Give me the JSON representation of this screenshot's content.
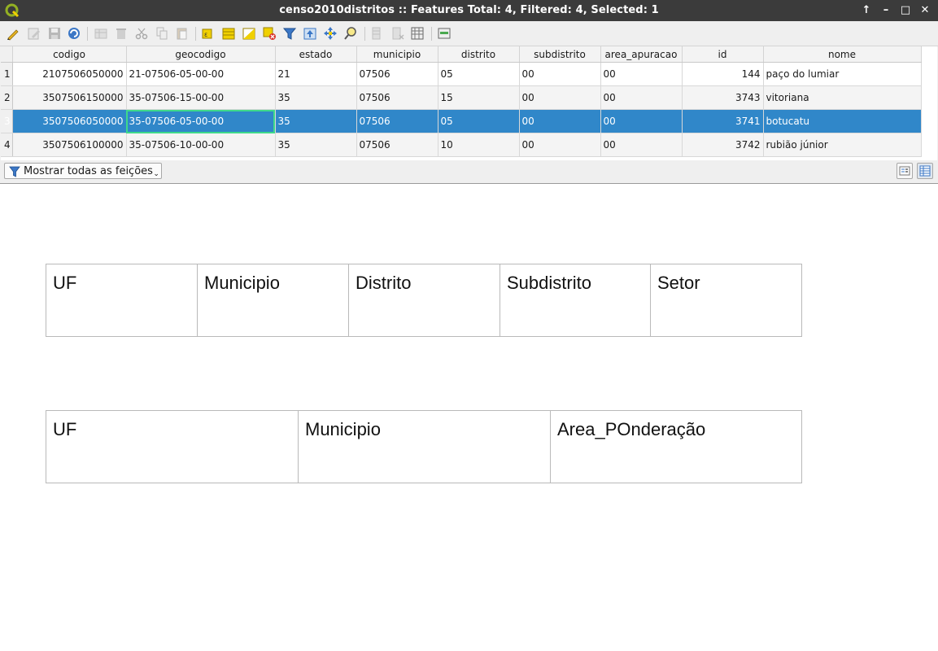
{
  "window": {
    "title": "censo2010distritos :: Features Total: 4, Filtered: 4, Selected: 1",
    "controls": [
      "↑",
      "–",
      "□",
      "✕"
    ]
  },
  "toolbar": {
    "icons": [
      "toggle-editing-icon",
      "multi-edit-icon",
      "save-edits-icon",
      "reload-icon",
      "add-feature-icon",
      "delete-feature-icon",
      "cut-icon",
      "copy-icon",
      "paste-icon",
      "select-by-expression-icon",
      "select-all-icon",
      "invert-selection-icon",
      "deselect-all-icon",
      "filter-select-icon",
      "move-selection-top-icon",
      "pan-to-selection-icon",
      "zoom-to-selection-icon",
      "new-field-icon",
      "delete-field-icon",
      "field-calculator-icon",
      "conditional-formatting-icon"
    ]
  },
  "table": {
    "columns": [
      "codigo",
      "geocodigo",
      "estado",
      "municipio",
      "distrito",
      "subdistrito",
      "area_apuracao",
      "id",
      "nome"
    ],
    "rows": [
      {
        "num": "1",
        "cells": [
          "2107506050000",
          "21-07506-05-00-00",
          "21",
          "07506",
          "05",
          "00",
          "00",
          "144",
          "paço do lumiar"
        ]
      },
      {
        "num": "2",
        "cells": [
          "3507506150000",
          "35-07506-15-00-00",
          "35",
          "07506",
          "15",
          "00",
          "00",
          "3743",
          "vitoriana"
        ]
      },
      {
        "num": "3",
        "cells": [
          "3507506050000",
          "35-07506-05-00-00",
          "35",
          "07506",
          "05",
          "00",
          "00",
          "3741",
          "botucatu"
        ]
      },
      {
        "num": "4",
        "cells": [
          "3507506100000",
          "35-07506-10-00-00",
          "35",
          "07506",
          "10",
          "00",
          "00",
          "3742",
          "rubião júnior"
        ]
      }
    ],
    "selected_row": 3,
    "current_cell": "geocodigo"
  },
  "bottom": {
    "filter_label": "Mostrar todas as feições"
  },
  "layout_table_1": {
    "headers": [
      "UF",
      "Municipio",
      "Distrito",
      "Subdistrito",
      "Setor"
    ]
  },
  "layout_table_2": {
    "headers": [
      "UF",
      "Municipio",
      "Area_POnderação"
    ]
  },
  "colors": {
    "selection": "#3087c9",
    "current_cell_outline": "#3ed98b",
    "titlebar": "#3b3b3b"
  }
}
